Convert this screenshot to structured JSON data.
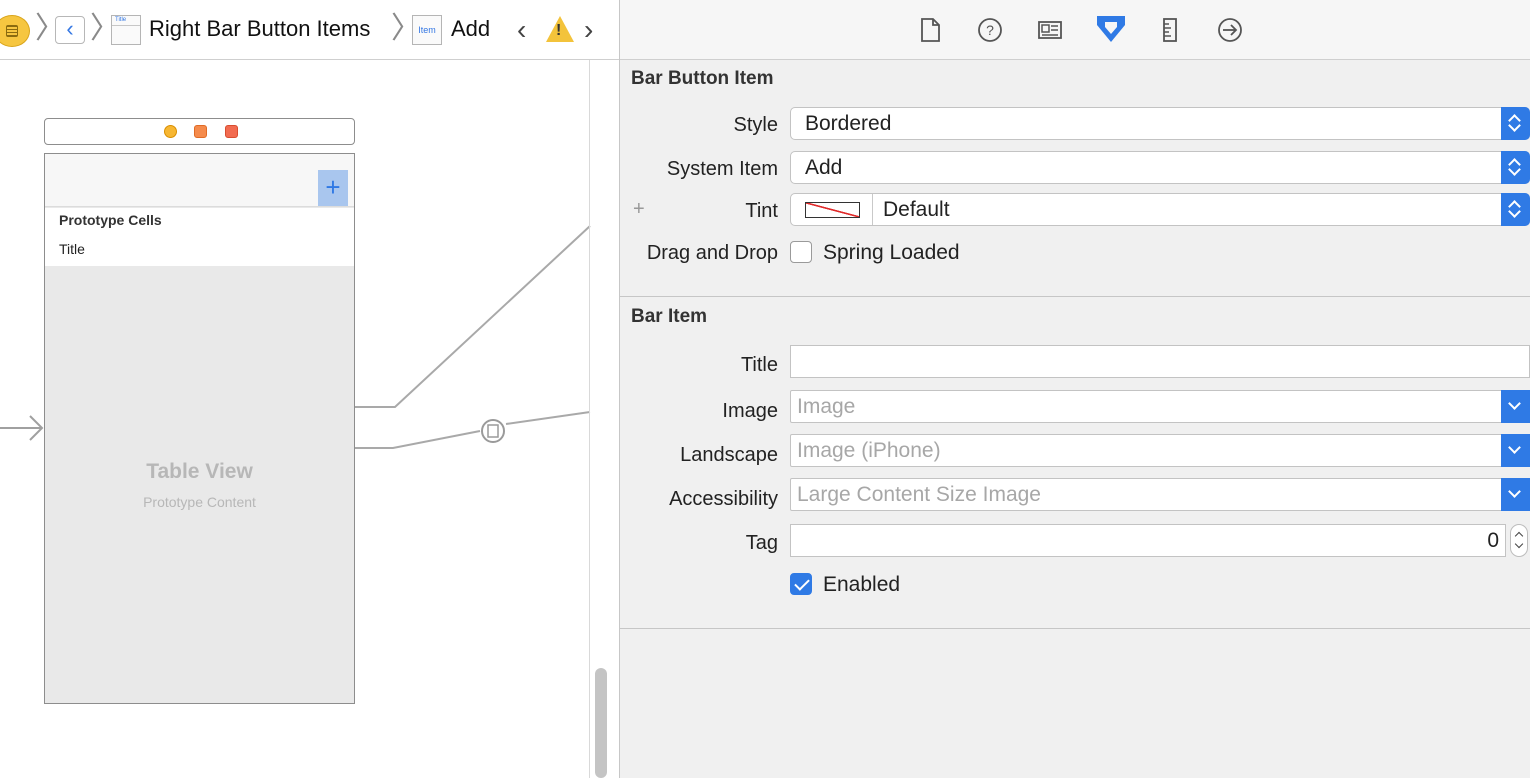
{
  "jump_bar": {
    "nav_item_icon_text": "Title",
    "breadcrumb_title": "Right Bar Button Items",
    "item_icon_text": "Item",
    "current_item": "Add"
  },
  "canvas": {
    "add_symbol": "+",
    "prototype_cells_label": "Prototype Cells",
    "cell_title": "Title",
    "table_view_label": "Table View",
    "table_view_sublabel": "Prototype Content"
  },
  "inspector": {
    "toolbar_icons": [
      "file-icon",
      "quick-help-icon",
      "identity-icon",
      "attributes-icon",
      "size-icon",
      "connections-icon"
    ],
    "accent_color": "#2f7ae5",
    "bar_button_item": {
      "title": "Bar Button Item",
      "style_label": "Style",
      "style_value": "Bordered",
      "system_item_label": "System Item",
      "system_item_value": "Add",
      "tint_plus": "+",
      "tint_label": "Tint",
      "tint_value": "Default",
      "drag_drop_label": "Drag and Drop",
      "spring_loaded_label": "Spring Loaded",
      "spring_loaded_checked": false
    },
    "bar_item": {
      "title": "Bar Item",
      "title_label": "Title",
      "title_value": "",
      "image_label": "Image",
      "image_placeholder": "Image",
      "landscape_label": "Landscape",
      "landscape_placeholder": "Image (iPhone)",
      "accessibility_label": "Accessibility",
      "accessibility_placeholder": "Large Content Size Image",
      "tag_label": "Tag",
      "tag_value": "0",
      "enabled_label": "Enabled",
      "enabled_checked": true
    }
  }
}
